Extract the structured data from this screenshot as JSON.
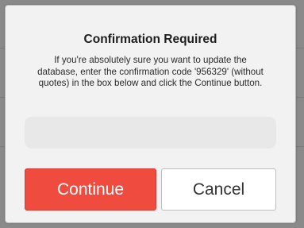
{
  "dialog": {
    "title": "Confirmation Required",
    "message_lines": [
      "If you're absolutely sure you want to update the",
      "database, enter the confirmation code '956329' (without",
      "quotes) in the box below and click the Continue button."
    ],
    "confirmation_code_input": {
      "value": "",
      "placeholder": ""
    },
    "continue_label": "Continue",
    "cancel_label": "Cancel"
  },
  "colors": {
    "continue_button": "#ef4b3f",
    "dialog_background": "#f2f2f2",
    "overlay": "#8a8a8a"
  }
}
